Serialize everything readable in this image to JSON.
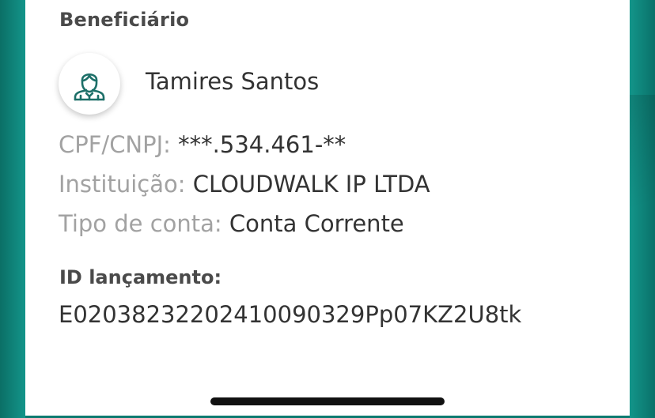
{
  "beneficiary": {
    "section_title": "Beneficiário",
    "avatar_icon": "person-icon",
    "name": "Tamires Santos",
    "fields": [
      {
        "label": "CPF/CNPJ:",
        "value": "***.534.461-**"
      },
      {
        "label": "Instituição:",
        "value": "CLOUDWALK IP LTDA"
      },
      {
        "label": "Tipo de conta:",
        "value": "Conta Corrente"
      }
    ]
  },
  "launch": {
    "title": "ID lançamento:",
    "value": "E02038232202410090329Pp07KZ2U8tk"
  },
  "colors": {
    "background_teal": "#0f8f84",
    "card": "#ffffff",
    "label_gray": "#a2a2a2",
    "text_dark": "#333333",
    "title_gray": "#4a4a4a"
  }
}
